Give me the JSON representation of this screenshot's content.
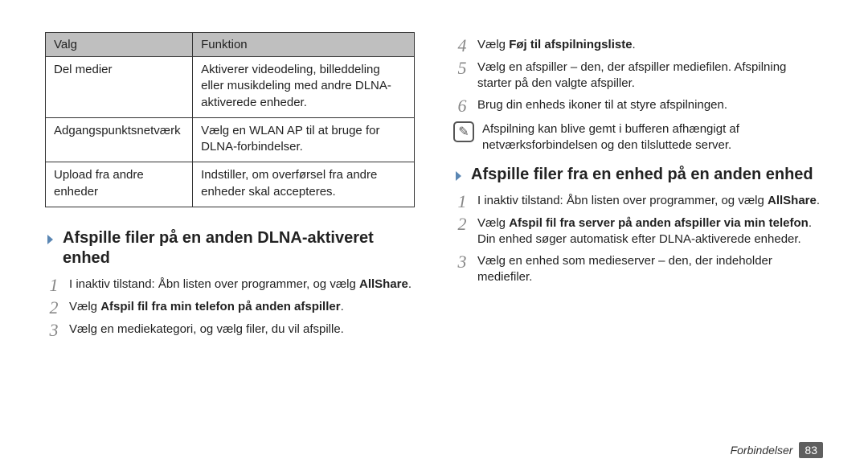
{
  "table": {
    "headers": {
      "col1": "Valg",
      "col2": "Funktion"
    },
    "rows": [
      {
        "c1": "Del medier",
        "c2": "Aktiverer videodeling, billeddeling eller musikdeling med andre DLNA-aktiverede enheder."
      },
      {
        "c1": "Adgangspunktsnetværk",
        "c2": "Vælg en WLAN AP til at bruge for DLNA-forbindelser."
      },
      {
        "c1": "Upload fra andre enheder",
        "c2": "Indstiller, om overførsel fra andre enheder skal accepteres."
      }
    ]
  },
  "left": {
    "section_title": "Afspille filer på en anden DLNA-aktiveret enhed",
    "step1_text": "I inaktiv tilstand: Åbn listen over programmer, og vælg ",
    "step1_bold": "AllShare",
    "step1_tail": ".",
    "step2_pre": "Vælg ",
    "step2_bold": "Afspil fil fra min telefon på anden afspiller",
    "step2_tail": ".",
    "step3": "Vælg en mediekategori, og vælg filer, du vil afspille."
  },
  "right": {
    "step4_pre": "Vælg ",
    "step4_bold": "Føj til afspilningsliste",
    "step4_tail": ".",
    "step5": "Vælg en afspiller – den, der afspiller mediefilen. Afspilning starter på den valgte afspiller.",
    "step6": "Brug din enheds ikoner til at styre afspilningen.",
    "note": "Afspilning kan blive gemt i bufferen afhængigt af netværksforbindelsen og den tilsluttede server.",
    "section_title": "Afspille filer fra en enhed på en anden enhed",
    "b_step1_text": "I inaktiv tilstand: Åbn listen over programmer, og vælg ",
    "b_step1_bold": "AllShare",
    "b_step1_tail": ".",
    "b_step2_pre": "Vælg ",
    "b_step2_bold": "Afspil fil fra server på anden afspiller via min telefon",
    "b_step2_tail": ".",
    "b_step2_extra": "Din enhed søger automatisk efter DLNA-aktiverede enheder.",
    "b_step3": "Vælg en enhed som medieserver – den, der indeholder mediefiler."
  },
  "footer": {
    "label": "Forbindelser",
    "page": "83"
  },
  "nums": {
    "n1": "1",
    "n2": "2",
    "n3": "3",
    "n4": "4",
    "n5": "5",
    "n6": "6"
  },
  "icons": {
    "note_glyph": "✎"
  }
}
